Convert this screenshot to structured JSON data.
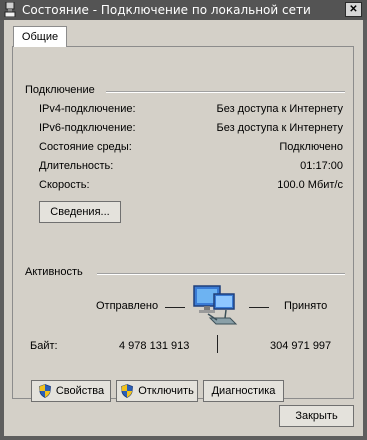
{
  "window": {
    "title": "Состояние - Подключение по локальной сети",
    "close_glyph": "✕",
    "icons": {
      "title": "network-adapter-icon",
      "close": "close-icon"
    }
  },
  "tabs": [
    {
      "label": "Общие",
      "selected": true
    }
  ],
  "connection": {
    "group_label": "Подключение",
    "rows": [
      {
        "label": "IPv4-подключение:",
        "value": "Без доступа к Интернету"
      },
      {
        "label": "IPv6-подключение:",
        "value": "Без доступа к Интернету"
      },
      {
        "label": "Состояние среды:",
        "value": "Подключено"
      },
      {
        "label": "Длительность:",
        "value": "01:17:00"
      },
      {
        "label": "Скорость:",
        "value": "100.0 Мбит/с"
      }
    ],
    "details_button": "Сведения..."
  },
  "activity": {
    "group_label": "Активность",
    "sent_label": "Отправлено",
    "received_label": "Принято",
    "bytes_label": "Байт:",
    "bytes_sent": "4 978 131 913",
    "bytes_received": "304 971 997",
    "icon": "network-activity-icon"
  },
  "buttons": {
    "properties": "Свойства",
    "disable": "Отключить",
    "diagnose": "Диагностика",
    "close": "Закрыть",
    "shield_icon": "uac-shield-icon"
  },
  "colors": {
    "titlebar": "#545454",
    "dialog_bg": "#d4d0c8",
    "tab_bg": "#ffffff",
    "shield_blue": "#2a5fb8",
    "shield_yellow": "#f2c21b"
  }
}
